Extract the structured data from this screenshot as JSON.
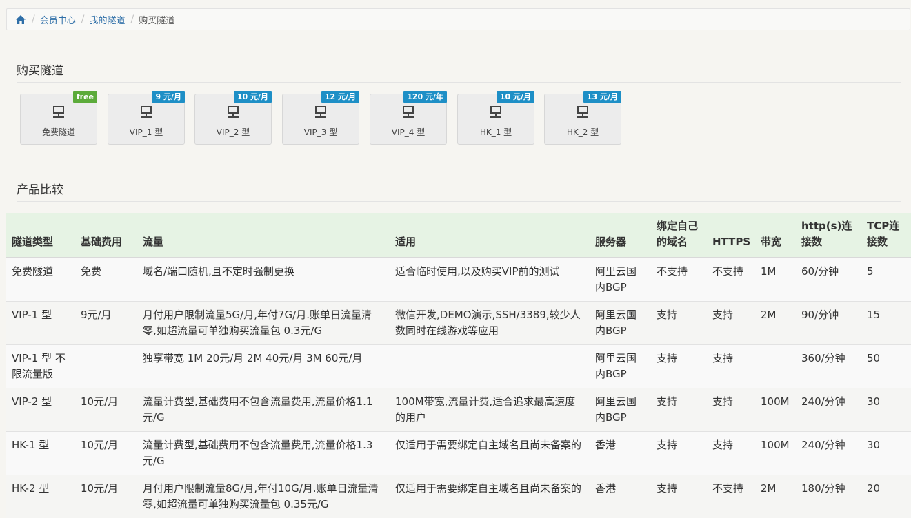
{
  "breadcrumb": {
    "home_icon": "home-icon",
    "items": [
      "会员中心",
      "我的隧道"
    ],
    "current": "购买隧道"
  },
  "sections": {
    "buy_title": "购买隧道",
    "compare_title": "产品比较"
  },
  "plans": [
    {
      "label": "免费隧道",
      "badge": "free",
      "badge_color": "#5cab3a",
      "icon": "network-icon"
    },
    {
      "label": "VIP_1 型",
      "badge": "9 元/月",
      "badge_color": "#1e8fc6",
      "icon": "network-icon"
    },
    {
      "label": "VIP_2 型",
      "badge": "10 元/月",
      "badge_color": "#1e8fc6",
      "icon": "network-icon"
    },
    {
      "label": "VIP_3 型",
      "badge": "12 元/月",
      "badge_color": "#1e8fc6",
      "icon": "network-icon"
    },
    {
      "label": "VIP_4 型",
      "badge": "120 元/年",
      "badge_color": "#1e8fc6",
      "icon": "network-icon"
    },
    {
      "label": "HK_1 型",
      "badge": "10 元/月",
      "badge_color": "#1e8fc6",
      "icon": "network-icon"
    },
    {
      "label": "HK_2 型",
      "badge": "13 元/月",
      "badge_color": "#1e8fc6",
      "icon": "network-icon"
    }
  ],
  "table": {
    "headers": [
      "隧道类型",
      "基础费用",
      "流量",
      "适用",
      "服务器",
      "绑定自己的域名",
      "HTTPS",
      "带宽",
      "http(s)连接数",
      "TCP连接数"
    ],
    "rows": [
      [
        "免费隧道",
        "免费",
        "域名/端口随机,且不定时强制更换",
        "适合临时使用,以及购买VIP前的测试",
        "阿里云国内BGP",
        "不支持",
        "不支持",
        "1M",
        "60/分钟",
        "5"
      ],
      [
        "VIP-1 型",
        "9元/月",
        "月付用户限制流量5G/月,年付7G/月.账单日流量清零,如超流量可单独购买流量包 0.3元/G",
        "微信开发,DEMO演示,SSH/3389,较少人数同时在线游戏等应用",
        "阿里云国内BGP",
        "支持",
        "支持",
        "2M",
        "90/分钟",
        "15"
      ],
      [
        "VIP-1 型 不限流量版",
        "",
        "独享带宽 1M 20元/月 2M 40元/月 3M 60元/月",
        "",
        "阿里云国内BGP",
        "支持",
        "支持",
        "",
        "360/分钟",
        "50"
      ],
      [
        "VIP-2 型",
        "10元/月",
        "流量计费型,基础费用不包含流量费用,流量价格1.1元/G",
        "100M带宽,流量计费,适合追求最高速度的用户",
        "阿里云国内BGP",
        "支持",
        "支持",
        "100M",
        "240/分钟",
        "30"
      ],
      [
        "HK-1 型",
        "10元/月",
        "流量计费型,基础费用不包含流量费用,流量价格1.3元/G",
        "仅适用于需要绑定自主域名且尚未备案的",
        "香港",
        "支持",
        "支持",
        "100M",
        "240/分钟",
        "30"
      ],
      [
        "HK-2 型",
        "10元/月",
        "月付用户限制流量8G/月,年付10G/月.账单日流量清零,如超流量可单独购买流量包 0.35元/G",
        "仅适用于需要绑定自主域名且尚未备案的",
        "香港",
        "支持",
        "不支持",
        "2M",
        "180/分钟",
        "20"
      ]
    ]
  }
}
